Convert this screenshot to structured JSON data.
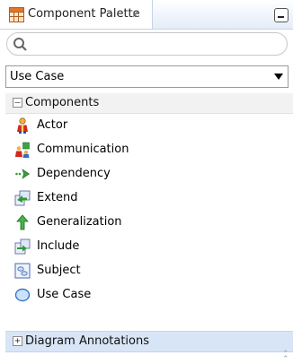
{
  "window": {
    "title": "Component Palette",
    "close_glyph": "x",
    "tab_icon": "palette-grid-icon",
    "minimize_icon": "minimize-icon"
  },
  "search": {
    "placeholder": "",
    "value": "",
    "icon": "search-icon"
  },
  "category_select": {
    "selected": "Use Case"
  },
  "sections": [
    {
      "label": "Components",
      "toggle": "–",
      "expanded": true,
      "items": [
        {
          "label": "Actor",
          "icon": "actor-icon"
        },
        {
          "label": "Communication",
          "icon": "communication-icon"
        },
        {
          "label": "Dependency",
          "icon": "dependency-icon"
        },
        {
          "label": "Extend",
          "icon": "extend-icon"
        },
        {
          "label": "Generalization",
          "icon": "generalization-icon"
        },
        {
          "label": "Include",
          "icon": "include-icon"
        },
        {
          "label": "Subject",
          "icon": "subject-icon"
        },
        {
          "label": "Use Case",
          "icon": "use-case-icon"
        }
      ]
    },
    {
      "label": "Diagram Annotations",
      "toggle": "+",
      "expanded": false,
      "items": []
    }
  ],
  "colors": {
    "accent": "#d8e5f7",
    "border": "#c5d3e6"
  }
}
